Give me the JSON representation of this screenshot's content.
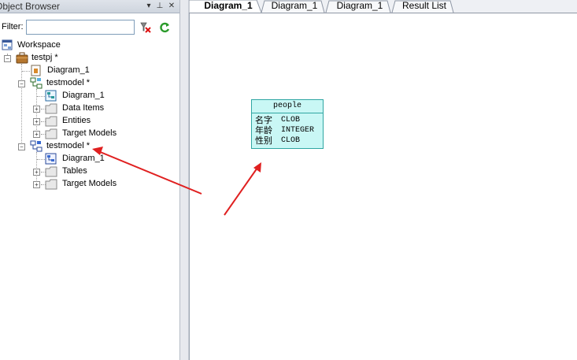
{
  "object_browser": {
    "title": "Object Browser",
    "filter_label": "Filter:",
    "filter_value": ""
  },
  "tree": {
    "workspace": "Workspace",
    "project": "testpj *",
    "project_diagram": "Diagram_1",
    "model1": {
      "label": "testmodel *",
      "diagram": "Diagram_1",
      "folders": [
        "Data Items",
        "Entities",
        "Target Models"
      ]
    },
    "model2": {
      "label": "testmodel *",
      "diagram": "Diagram_1",
      "folders": [
        "Tables",
        "Target Models"
      ]
    }
  },
  "tabs": [
    "Diagram_1",
    "Diagram_1",
    "Diagram_1",
    "Result List"
  ],
  "entity": {
    "name": "people",
    "attributes": [
      {
        "name": "名字",
        "type": "CLOB"
      },
      {
        "name": "年龄",
        "type": "INTEGER"
      },
      {
        "name": "性别",
        "type": "CLOB"
      }
    ]
  },
  "colors": {
    "entity_fill": "#c9f7f5",
    "entity_border": "#2fa6a3",
    "arrow": "#e02020"
  }
}
